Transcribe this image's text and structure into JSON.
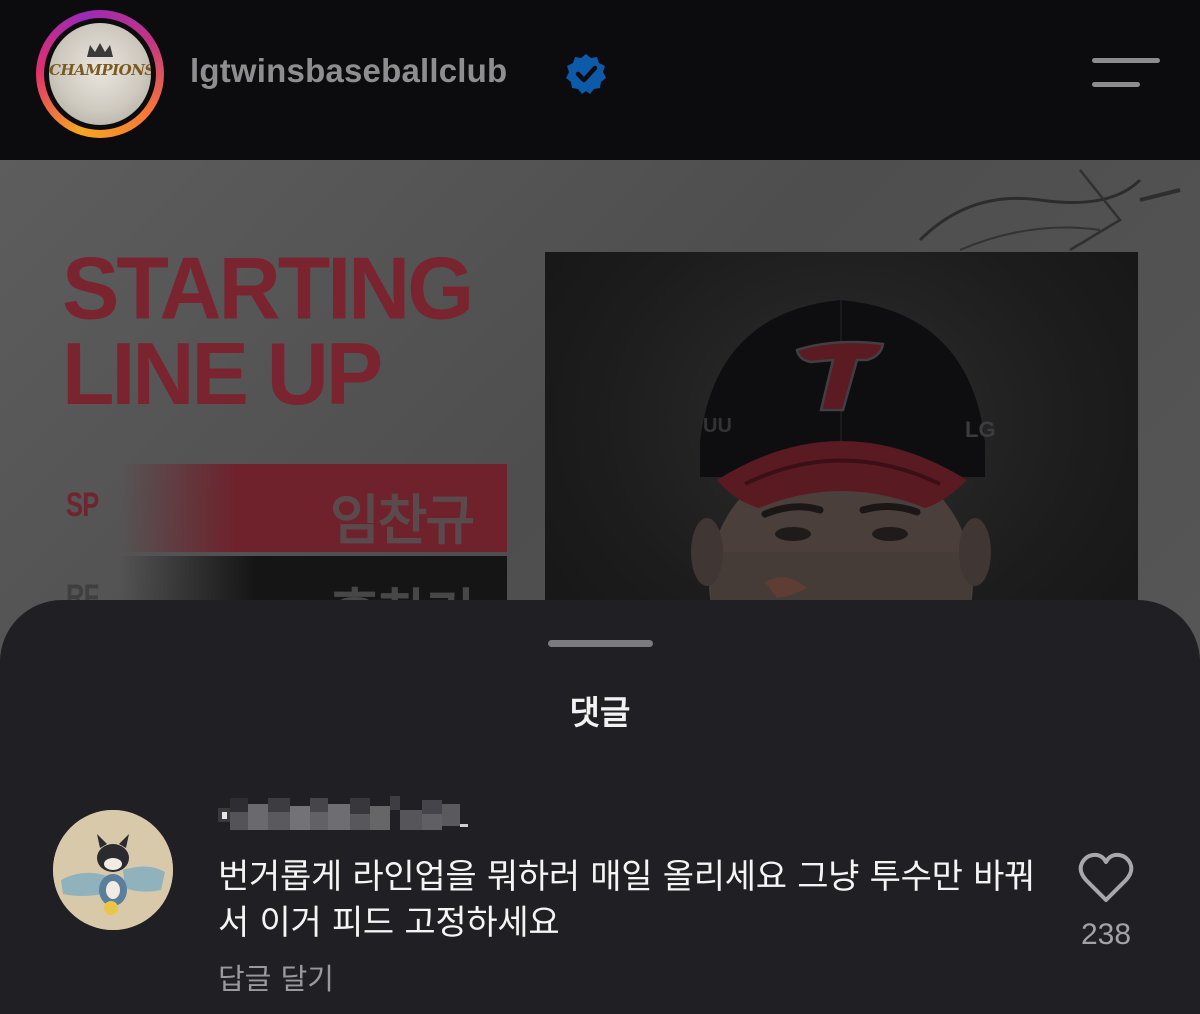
{
  "header": {
    "avatar_logo_text": "CHAMPIONS",
    "username": "lgtwinsbaseballclub",
    "verified_color": "#0095f6"
  },
  "post_image": {
    "headline_line1": "STARTING",
    "headline_line2": "LINE UP",
    "lineup": [
      {
        "position": "SP",
        "player": "임찬규"
      },
      {
        "position": "RF",
        "player": "홍창기"
      }
    ],
    "cap_logo": "T",
    "cap_side_text": "LG"
  },
  "comments_sheet": {
    "title": "댓글",
    "comment": {
      "username": "",
      "text": "번거롭게 라인업을 뭐하러 매일 올리세요 그냥 투수만 바꿔서 이거 피드 고정하세요",
      "reply_label": "답글 달기",
      "like_count": "238"
    }
  },
  "icons": {
    "menu": "hamburger-menu-icon",
    "verified": "verified-badge-icon",
    "like": "heart-outline-icon"
  }
}
